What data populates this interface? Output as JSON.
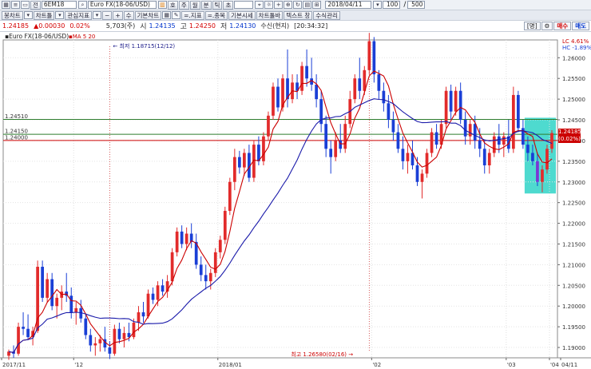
{
  "toolbar1": {
    "icons": [
      "grid-icon",
      "list-icon",
      "window-icon"
    ],
    "jeon_label": "전",
    "symbol_code": "6EM18",
    "symbol_name": "Euro FX(18-06/USD)",
    "btn_ho": "호",
    "btn_ju": "주",
    "btn_wol": "월",
    "btn_bun": "분",
    "btn_tik": "틱",
    "btn_cho": "초",
    "date_value": "2018/04/11",
    "count_value": "100",
    "page_value": "500"
  },
  "toolbar2": {
    "btn_bongchart": "봉차트",
    "btn_chartteul": "차트틀",
    "btn_gwansim": "관심지표",
    "btn_minus": "−",
    "btn_plus": "+",
    "btn_su": "수",
    "btn_gibonchart": "기본차트",
    "btn_jipyo": "=.지표",
    "btn_jongmok": "=.종목",
    "btn_gibonsise": "기본시세",
    "btn_charttoolbar": "차트툴바",
    "btn_textbar": "텍스트 창",
    "btn_susikmanage": "수식관리"
  },
  "quote": {
    "last": "1.24185",
    "change": "▲0.00030",
    "change_pct": "0.02%",
    "volume": "5,703(주)",
    "open_label": "시",
    "open": "1.24135",
    "high_label": "고",
    "high": "1.24250",
    "low_label": "저",
    "low": "1.24130",
    "status": "수신(현지)",
    "time": "[20:34:32]",
    "btn_myeong": "[명]",
    "btn_settings": "⚙",
    "btn_buy": "매수",
    "btn_sell": "매도"
  },
  "chart_data": {
    "type": "candlestick",
    "title": "Euro FX(18-06/USD)",
    "indicator_label": "MA 5 20",
    "y_ticks": [
      "1.26000",
      "1.25500",
      "1.25000",
      "1.24500",
      "1.24000",
      "1.23500",
      "1.23000",
      "1.22500",
      "1.22000",
      "1.21500",
      "1.21000",
      "1.20500",
      "1.20000",
      "1.19500",
      "1.19000"
    ],
    "ylim": [
      1.1875,
      1.2643
    ],
    "x_labels": [
      "2017/11",
      "'12",
      "2018/01",
      "'02",
      "'03",
      "'04",
      "04/11"
    ],
    "hlines": [
      {
        "value": 1.2451,
        "label": "1.24510",
        "color": "#2f7d2f"
      },
      {
        "value": 1.2415,
        "label": "1.24150",
        "color": "#2f7d2f"
      },
      {
        "value": 1.24,
        "label": "1.24000",
        "color": "#cc0000"
      }
    ],
    "annotations": [
      {
        "text": "최저  1.18715(12/12)",
        "index": 21,
        "value": 1.18715
      },
      {
        "text": "최고  1.26580(02/16)",
        "index": 75,
        "value": 1.2658
      }
    ],
    "price_boxes": [
      {
        "text": "1.24185",
        "value": 1.24185
      },
      {
        "text": "(0.02%)",
        "value": 1.2407
      }
    ],
    "lc_label": "LC  4.61%",
    "hc_label": "HC -1.89%",
    "candles": [
      [
        1.188,
        1.1895,
        1.187,
        1.189
      ],
      [
        1.189,
        1.1905,
        1.1875,
        1.1885
      ],
      [
        1.1885,
        1.196,
        1.188,
        1.195
      ],
      [
        1.195,
        1.1985,
        1.193,
        1.1945
      ],
      [
        1.1945,
        1.198,
        1.192,
        1.1925
      ],
      [
        1.1925,
        1.195,
        1.1905,
        1.194
      ],
      [
        1.194,
        1.211,
        1.1935,
        1.2095
      ],
      [
        1.2095,
        1.211,
        1.201,
        1.202
      ],
      [
        1.202,
        1.208,
        1.201,
        1.2065
      ],
      [
        1.2065,
        1.208,
        1.199,
        1.2
      ],
      [
        1.2,
        1.203,
        1.197,
        1.202
      ],
      [
        1.202,
        1.205,
        1.199,
        1.2035
      ],
      [
        1.2035,
        1.208,
        1.201,
        1.2025
      ],
      [
        1.2025,
        1.2045,
        1.197,
        1.1985
      ],
      [
        1.1985,
        1.201,
        1.1955,
        1.1995
      ],
      [
        1.1995,
        1.2015,
        1.196,
        1.197
      ],
      [
        1.197,
        1.198,
        1.192,
        1.193
      ],
      [
        1.193,
        1.1945,
        1.189,
        1.1905
      ],
      [
        1.1905,
        1.1925,
        1.188,
        1.191
      ],
      [
        1.191,
        1.193,
        1.189,
        1.192
      ],
      [
        1.192,
        1.195,
        1.189,
        1.19
      ],
      [
        1.19,
        1.1915,
        1.1872,
        1.1885
      ],
      [
        1.1885,
        1.1955,
        1.188,
        1.1945
      ],
      [
        1.1945,
        1.196,
        1.191,
        1.192
      ],
      [
        1.192,
        1.195,
        1.19,
        1.1935
      ],
      [
        1.1935,
        1.196,
        1.1915,
        1.1925
      ],
      [
        1.1925,
        1.197,
        1.192,
        1.196
      ],
      [
        1.196,
        1.2,
        1.194,
        1.1985
      ],
      [
        1.1985,
        1.201,
        1.196,
        1.1975
      ],
      [
        1.1975,
        1.204,
        1.197,
        1.203
      ],
      [
        1.203,
        1.2045,
        1.2005,
        1.2015
      ],
      [
        1.2015,
        1.206,
        1.2,
        1.205
      ],
      [
        1.205,
        1.2065,
        1.2025,
        1.2035
      ],
      [
        1.2035,
        1.2075,
        1.202,
        1.206
      ],
      [
        1.206,
        1.214,
        1.205,
        1.213
      ],
      [
        1.213,
        1.219,
        1.212,
        1.218
      ],
      [
        1.218,
        1.2195,
        1.214,
        1.215
      ],
      [
        1.215,
        1.219,
        1.2135,
        1.2175
      ],
      [
        1.2175,
        1.22,
        1.214,
        1.2155
      ],
      [
        1.2155,
        1.2175,
        1.209,
        1.21
      ],
      [
        1.21,
        1.212,
        1.206,
        1.2075
      ],
      [
        1.2075,
        1.21,
        1.204,
        1.206
      ],
      [
        1.206,
        1.209,
        1.204,
        1.208
      ],
      [
        1.208,
        1.214,
        1.207,
        1.213
      ],
      [
        1.213,
        1.217,
        1.2115,
        1.216
      ],
      [
        1.216,
        1.224,
        1.215,
        1.223
      ],
      [
        1.223,
        1.231,
        1.222,
        1.23
      ],
      [
        1.23,
        1.238,
        1.228,
        1.236
      ],
      [
        1.236,
        1.2375,
        1.232,
        1.2335
      ],
      [
        1.2335,
        1.238,
        1.2315,
        1.237
      ],
      [
        1.237,
        1.239,
        1.23,
        1.231
      ],
      [
        1.231,
        1.24,
        1.23,
        1.239
      ],
      [
        1.239,
        1.241,
        1.234,
        1.235
      ],
      [
        1.235,
        1.242,
        1.234,
        1.241
      ],
      [
        1.241,
        1.247,
        1.24,
        1.246
      ],
      [
        1.246,
        1.254,
        1.245,
        1.253
      ],
      [
        1.253,
        1.255,
        1.247,
        1.248
      ],
      [
        1.248,
        1.256,
        1.247,
        1.255
      ],
      [
        1.255,
        1.262,
        1.248,
        1.25
      ],
      [
        1.25,
        1.256,
        1.249,
        1.254
      ],
      [
        1.254,
        1.256,
        1.25,
        1.252
      ],
      [
        1.252,
        1.259,
        1.251,
        1.258
      ],
      [
        1.258,
        1.262,
        1.253,
        1.255
      ],
      [
        1.255,
        1.26,
        1.252,
        1.2535
      ],
      [
        1.2535,
        1.256,
        1.248,
        1.25
      ],
      [
        1.25,
        1.252,
        1.242,
        1.244
      ],
      [
        1.244,
        1.246,
        1.236,
        1.238
      ],
      [
        1.238,
        1.24,
        1.232,
        1.236
      ],
      [
        1.236,
        1.242,
        1.235,
        1.24
      ],
      [
        1.24,
        1.244,
        1.237,
        1.238
      ],
      [
        1.238,
        1.246,
        1.237,
        1.244
      ],
      [
        1.244,
        1.252,
        1.243,
        1.25
      ],
      [
        1.25,
        1.256,
        1.249,
        1.255
      ],
      [
        1.255,
        1.26,
        1.25,
        1.252
      ],
      [
        1.252,
        1.258,
        1.251,
        1.257
      ],
      [
        1.257,
        1.266,
        1.256,
        1.264
      ],
      [
        1.264,
        1.265,
        1.254,
        1.256
      ],
      [
        1.256,
        1.257,
        1.25,
        1.252
      ],
      [
        1.252,
        1.254,
        1.247,
        1.249
      ],
      [
        1.249,
        1.251,
        1.243,
        1.245
      ],
      [
        1.245,
        1.247,
        1.24,
        1.242
      ],
      [
        1.242,
        1.244,
        1.237,
        1.238
      ],
      [
        1.238,
        1.241,
        1.233,
        1.235
      ],
      [
        1.235,
        1.239,
        1.232,
        1.237
      ],
      [
        1.237,
        1.24,
        1.233,
        1.234
      ],
      [
        1.234,
        1.236,
        1.229,
        1.23
      ],
      [
        1.23,
        1.233,
        1.226,
        1.232
      ],
      [
        1.232,
        1.238,
        1.231,
        1.237
      ],
      [
        1.237,
        1.243,
        1.236,
        1.242
      ],
      [
        1.242,
        1.244,
        1.238,
        1.239
      ],
      [
        1.239,
        1.245,
        1.238,
        1.244
      ],
      [
        1.244,
        1.253,
        1.243,
        1.252
      ],
      [
        1.252,
        1.2535,
        1.245,
        1.247
      ],
      [
        1.247,
        1.253,
        1.246,
        1.252
      ],
      [
        1.252,
        1.254,
        1.244,
        1.245
      ],
      [
        1.245,
        1.247,
        1.239,
        1.241
      ],
      [
        1.241,
        1.245,
        1.239,
        1.244
      ],
      [
        1.244,
        1.246,
        1.238,
        1.24
      ],
      [
        1.24,
        1.243,
        1.236,
        1.238
      ],
      [
        1.238,
        1.24,
        1.232,
        1.234
      ],
      [
        1.234,
        1.238,
        1.232,
        1.237
      ],
      [
        1.237,
        1.242,
        1.236,
        1.241
      ],
      [
        1.241,
        1.244,
        1.237,
        1.239
      ],
      [
        1.239,
        1.242,
        1.236,
        1.241
      ],
      [
        1.241,
        1.245,
        1.237,
        1.238
      ],
      [
        1.238,
        1.253,
        1.237,
        1.251
      ],
      [
        1.251,
        1.252,
        1.242,
        1.243
      ],
      [
        1.243,
        1.245,
        1.238,
        1.239
      ],
      [
        1.239,
        1.241,
        1.235,
        1.237
      ],
      [
        1.237,
        1.239,
        1.234,
        1.235
      ],
      [
        1.235,
        1.237,
        1.229,
        1.23
      ],
      [
        1.23,
        1.234,
        1.2275,
        1.233
      ],
      [
        1.233,
        1.239,
        1.232,
        1.238
      ],
      [
        1.238,
        1.2425,
        1.237,
        1.2418
      ]
    ],
    "ma_series": [
      {
        "name": "MA 5",
        "color": "#cc0000"
      },
      {
        "name": "MA 20",
        "color": "#1a1aaa"
      }
    ],
    "highlight": {
      "color": "#2fd3c7"
    }
  }
}
